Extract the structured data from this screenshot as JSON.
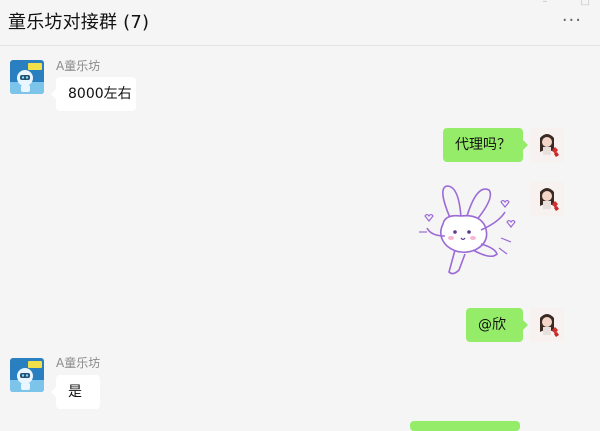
{
  "window": {
    "title": "童乐坊对接群 (7)",
    "more_icon": "more-dots-icon"
  },
  "colors": {
    "background": "#f5f5f5",
    "incoming_bubble": "#ffffff",
    "outgoing_bubble": "#95ec69",
    "sender_name": "#8a8a8a"
  },
  "messages": [
    {
      "direction": "incoming",
      "sender": "A童乐坊",
      "type": "text",
      "text": "8000左右",
      "avatar": "robot-avatar-icon"
    },
    {
      "direction": "outgoing",
      "type": "text",
      "text": "代理吗？",
      "avatar": "user-avatar-icon"
    },
    {
      "direction": "outgoing",
      "type": "sticker",
      "sticker": "dancing-bunny-sticker",
      "avatar": "user-avatar-icon"
    },
    {
      "direction": "outgoing",
      "type": "text",
      "text": "@欣",
      "avatar": "user-avatar-icon"
    },
    {
      "direction": "incoming",
      "sender": "A童乐坊",
      "type": "text",
      "text": "是",
      "avatar": "robot-avatar-icon"
    }
  ]
}
